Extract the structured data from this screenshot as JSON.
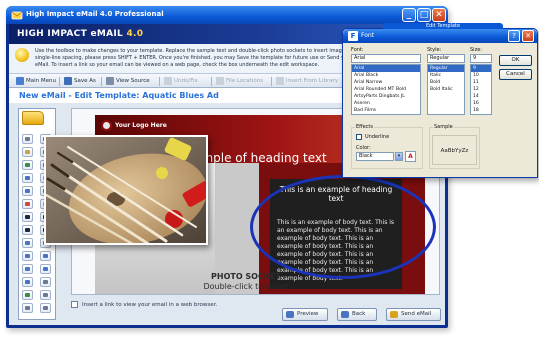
{
  "window": {
    "title": "High Impact eMail 4.0 Professional",
    "brand": "HIGH IMPACT eMAIL",
    "brand_version": "4.0",
    "controls": [
      "_",
      "□",
      "✕"
    ]
  },
  "instructions": "Use the toolbox to make changes to your template. Replace the sample text and double-click photo sockets to insert images. For single-line spacing, please press SHIFT + ENTER. Once you're finished, you may Save the template for future use or Send your eMail. To insert a link so your email can be viewed on a web page, check the box underneath the edit workspace.",
  "toolbar": {
    "main_menu": "Main Menu",
    "save_as": "Save As",
    "view_source": "View Source",
    "undo": "Undo/Fix",
    "file_locations": "File Locations",
    "insert_library": "Insert From Library"
  },
  "edit_title": "New eMail - Edit Template: Aquatic Blues Ad",
  "template": {
    "logo": "Your Logo Here",
    "heading_banner": "xample of heading text",
    "panel_heading": "This is an example of heading text",
    "body": "This is an example of body text. This is an example of body text. This is an example of body text. This is an example of body text. This is an example of body text. This is an example of body text. This is an example of body text. This is an example of body text.",
    "photo_socket": "PHOTO SOCKET",
    "photo_socket_hint": "Double-click to insert"
  },
  "web_checkbox_label": "Insert a link to view your email in a web browser.",
  "buttons": {
    "preview": "Preview",
    "back": "Back",
    "send": "Send eMail"
  },
  "font_dialog": {
    "caption": "Edit Template",
    "title": "Font",
    "font_label": "Font:",
    "font_value": "Arial",
    "style_label": "Style:",
    "style_value": "Regular",
    "size_label": "Size:",
    "size_value": "9",
    "fonts": [
      "Arial",
      "Arial Black",
      "Arial Narrow",
      "Arial Rounded MT Bold",
      "ArtsyParts Dingbats JL",
      "Aseren",
      "Bad Films"
    ],
    "styles": [
      "Regular",
      "Italic",
      "Bold",
      "Bold Italic"
    ],
    "sizes": [
      "9",
      "10",
      "11",
      "12",
      "14",
      "16",
      "18",
      "20",
      "22",
      "24",
      "26",
      "28",
      "36"
    ],
    "ok": "OK",
    "cancel": "Cancel",
    "effects_label": "Effects",
    "underline_label": "Underline",
    "color_label": "Color:",
    "color_value": "Black",
    "sample_label": "Sample",
    "sample_text": "AaBbYyZz"
  },
  "colors": {
    "title_bar": "#0a58d6",
    "frame": "#0b2f8f",
    "heading_blue": "#2a72d8",
    "template_red": "#a01414",
    "highlight_ring": "#1a33b8"
  }
}
